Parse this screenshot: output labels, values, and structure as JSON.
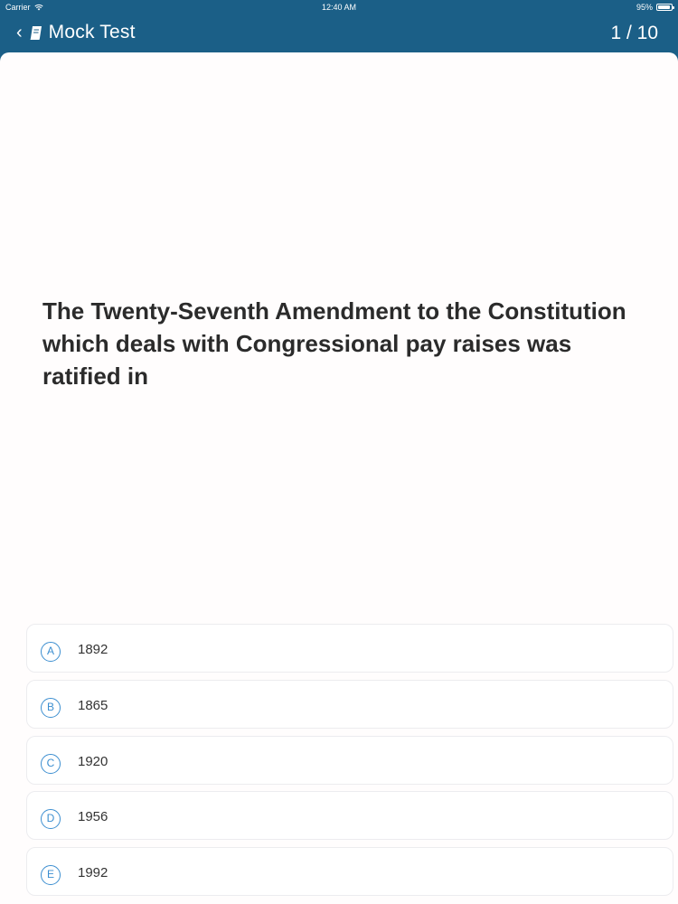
{
  "status_bar": {
    "carrier": "Carrier",
    "time": "12:40 AM",
    "battery": "95%",
    "battery_level": 0.95
  },
  "nav": {
    "back_icon": "chevron-left-icon",
    "book_icon": "book-icon",
    "title": "Mock Test",
    "progress": "1 / 10"
  },
  "question": {
    "text": "The Twenty-Seventh Amendment to the Constitution which deals with Congressional pay raises was ratified in"
  },
  "answers": [
    {
      "letter": "A",
      "text": "1892"
    },
    {
      "letter": "B",
      "text": "1865"
    },
    {
      "letter": "C",
      "text": "1920"
    },
    {
      "letter": "D",
      "text": "1956"
    },
    {
      "letter": "E",
      "text": "1992"
    }
  ],
  "colors": {
    "header": "#1b5f87",
    "badge": "#3b8ed0"
  }
}
